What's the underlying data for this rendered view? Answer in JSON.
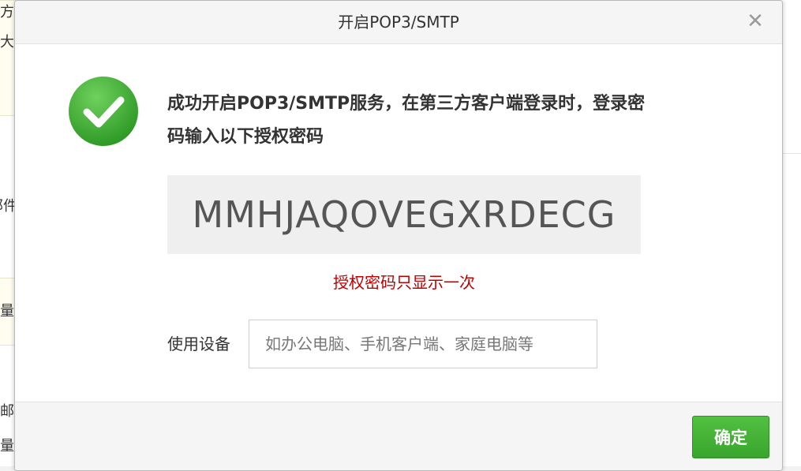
{
  "background": {
    "fragments": [
      "方",
      "大",
      "邮件",
      "量",
      "邮",
      "量"
    ]
  },
  "dialog": {
    "title": "开启POP3/SMTP",
    "close_symbol": "✕",
    "success_icon": "checkmark-circle-icon",
    "success_message": "成功开启POP3/SMTP服务，在第三方客户端登录时，登录密码输入以下授权密码",
    "auth_code": "MMHJAQOVEGXRDECG",
    "warning": "授权密码只显示一次",
    "device_label": "使用设备",
    "device_input": {
      "value": "",
      "placeholder": "如办公电脑、手机客户端、家庭电脑等"
    },
    "confirm_label": "确定"
  },
  "colors": {
    "success_green": "#3fae34",
    "warning_red": "#c00000",
    "confirm_button": "#44b236"
  }
}
